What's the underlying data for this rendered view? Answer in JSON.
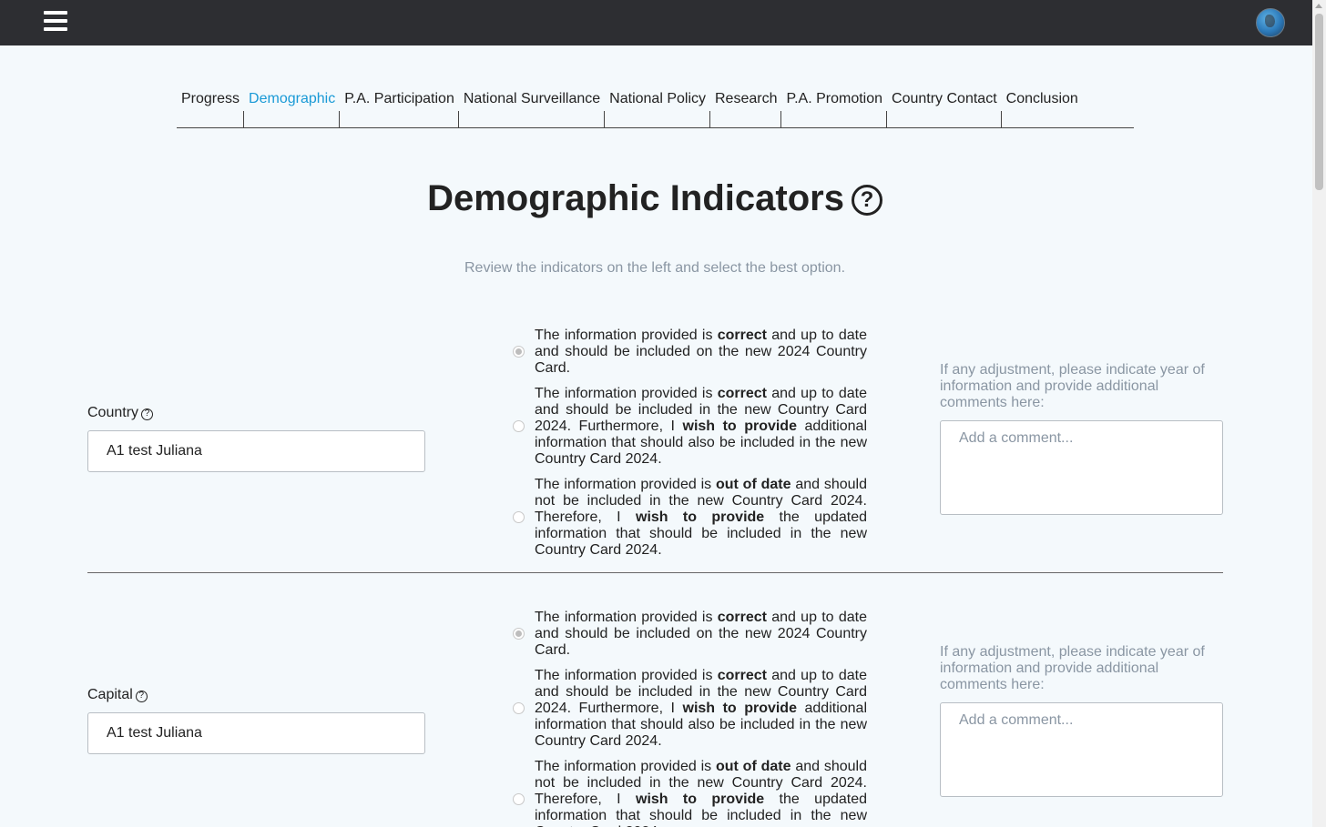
{
  "header": {
    "menu_icon": "hamburger-menu-icon",
    "profile_icon": "globe-icon"
  },
  "tabs": [
    {
      "label": "Progress",
      "active": false
    },
    {
      "label": "Demographic",
      "active": true
    },
    {
      "label": "P.A. Participation",
      "active": false
    },
    {
      "label": "National Surveillance",
      "active": false
    },
    {
      "label": "National Policy",
      "active": false
    },
    {
      "label": "Research",
      "active": false
    },
    {
      "label": "P.A. Promotion",
      "active": false
    },
    {
      "label": "Country Contact",
      "active": false
    },
    {
      "label": "Conclusion",
      "active": false
    }
  ],
  "page": {
    "title": "Demographic Indicators",
    "help_glyph": "?",
    "subtitle": "Review the indicators on the left and select the best option."
  },
  "options": {
    "opt1_a": "The information provided is ",
    "opt1_b": "correct",
    "opt1_c": " and up to date and should be included on the new 2024 Country Card.",
    "opt2_a": "The information provided is ",
    "opt2_b": "correct",
    "opt2_c": " and up to date and should be included in the new Country Card 2024. Furthermore, I ",
    "opt2_d": "wish to provide",
    "opt2_e": " additional information that should also be included in the new Country Card 2024.",
    "opt3_a": "The information provided is ",
    "opt3_b": "out of date",
    "opt3_c": " and should not be included in the new Country Card 2024. Therefore, I ",
    "opt3_d": "wish to provide",
    "opt3_e": " the updated information that should be included in the new Country Card 2024."
  },
  "comment": {
    "hint": "If any adjustment, please indicate year of information and provide additional comments here:",
    "placeholder": "Add a comment..."
  },
  "indicators": [
    {
      "label": "Country",
      "value": "A1 test Juliana",
      "selected_option": 1
    },
    {
      "label": "Capital",
      "value": "A1 test Juliana",
      "selected_option": 1
    }
  ]
}
